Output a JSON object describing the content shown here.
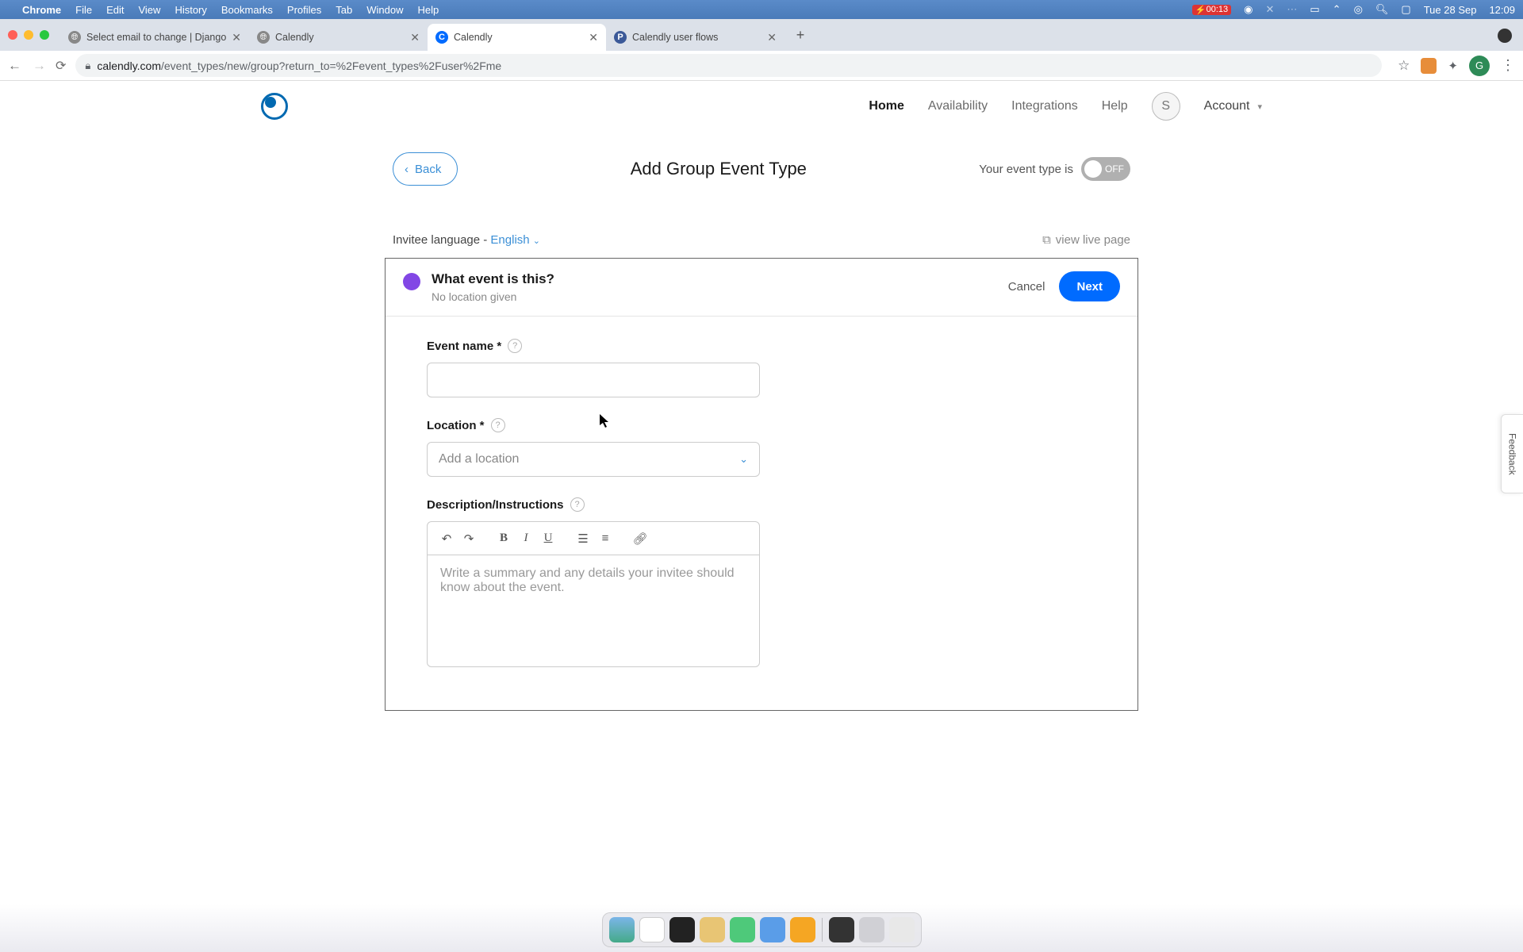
{
  "menubar": {
    "app": "Chrome",
    "items": [
      "File",
      "Edit",
      "View",
      "History",
      "Bookmarks",
      "Profiles",
      "Tab",
      "Window",
      "Help"
    ],
    "battery": "00:13",
    "date": "Tue 28 Sep",
    "time": "12:09"
  },
  "tabs": [
    {
      "title": "Select email to change | Django",
      "favicon": "globe"
    },
    {
      "title": "Calendly",
      "favicon": "globe"
    },
    {
      "title": "Calendly",
      "favicon": "c",
      "active": true
    },
    {
      "title": "Calendly user flows",
      "favicon": "p"
    }
  ],
  "url": {
    "host": "calendly.com",
    "path": "/event_types/new/group?return_to=%2Fevent_types%2Fuser%2Fme"
  },
  "profile_initial": "G",
  "nav": {
    "items": [
      "Home",
      "Availability",
      "Integrations",
      "Help"
    ],
    "active": "Home",
    "avatar": "S",
    "account": "Account"
  },
  "header": {
    "back": "Back",
    "title": "Add Group Event Type",
    "toggle_label": "Your event type is",
    "toggle_state": "OFF"
  },
  "subrow": {
    "lang_prefix": "Invitee language - ",
    "lang": "English",
    "live": "view live page"
  },
  "card": {
    "section_title": "What event is this?",
    "section_sub": "No location given",
    "cancel": "Cancel",
    "next": "Next",
    "fields": {
      "event_name": "Event name *",
      "location": "Location *",
      "location_placeholder": "Add a location",
      "description": "Description/Instructions",
      "description_placeholder": "Write a summary and any details your invitee should know about the event."
    }
  },
  "feedback": "Feedback",
  "colors": {
    "primary_blue": "#006bff",
    "link_blue": "#3b8fd6",
    "dot_purple": "#8247e5"
  }
}
